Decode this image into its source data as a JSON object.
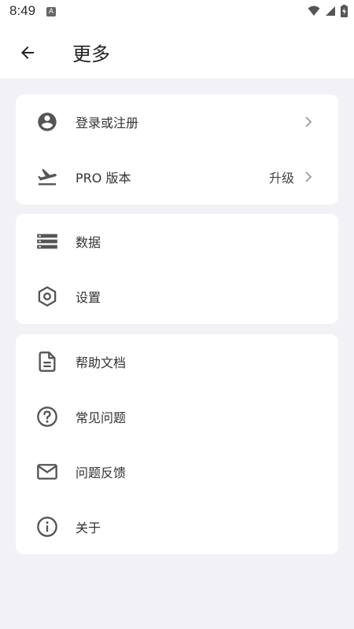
{
  "status_bar": {
    "time": "8:49",
    "notification_badge": "A"
  },
  "header": {
    "title": "更多"
  },
  "sections": [
    {
      "items": [
        {
          "label": "登录或注册",
          "icon": "account-circle-icon"
        },
        {
          "label": "PRO 版本",
          "icon": "flight-takeoff-icon",
          "trailing": "升级"
        }
      ]
    },
    {
      "items": [
        {
          "label": "数据",
          "icon": "storage-icon"
        },
        {
          "label": "设置",
          "icon": "settings-icon"
        }
      ]
    },
    {
      "items": [
        {
          "label": "帮助文档",
          "icon": "document-icon"
        },
        {
          "label": "常见问题",
          "icon": "help-circle-icon"
        },
        {
          "label": "问题反馈",
          "icon": "mail-icon"
        },
        {
          "label": "关于",
          "icon": "info-icon"
        }
      ]
    }
  ],
  "colors": {
    "background": "#f2f1f6",
    "card": "#ffffff",
    "icon": "#555555",
    "chevron": "#9a9a9a"
  }
}
